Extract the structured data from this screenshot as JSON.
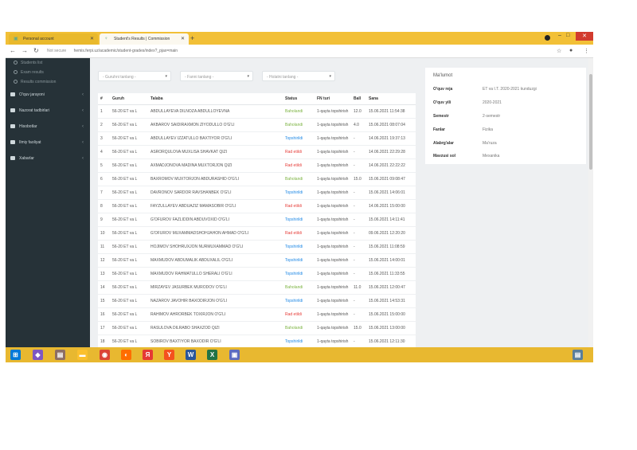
{
  "browser": {
    "tabs": [
      {
        "label": "Personal account"
      },
      {
        "label": "Student's Results | Commission"
      }
    ],
    "url": "hemis.ferpi.uz/academic/student-grades/index?_pjax=main",
    "url_security": "Not secure"
  },
  "sidebar": {
    "sub_items": [
      {
        "label": "Students list"
      },
      {
        "label": "Exam results"
      },
      {
        "label": "Results commission"
      }
    ],
    "items": [
      {
        "label": "O'quv jarayoni"
      },
      {
        "label": "Nazorat tadbirlari"
      },
      {
        "label": "Hisobotlar"
      },
      {
        "label": "Ilmiy faoliyat"
      },
      {
        "label": "Xabarlar"
      }
    ]
  },
  "filters": {
    "f1": "- Guruhni tanlang -",
    "f2": "- Fanni tanlang -",
    "f3": "- Holatni tanlang -"
  },
  "table": {
    "headers": [
      "#",
      "Guruh",
      "Talaba",
      "Status",
      "FN turi",
      "Ball",
      "Sana"
    ],
    "rows": [
      {
        "n": "1",
        "group": "56-20 ET va L",
        "student": "ABDULLAYEVA DILNOZA ABDULLOYEVNA",
        "status": "Baholandi",
        "type": "1-qayta topshirish",
        "score": "12.0",
        "date": "15.06.2021 11:54:38",
        "cls": "ok"
      },
      {
        "n": "2",
        "group": "56-20 ET va L",
        "student": "AKBAROV SAIDIRAXMON ZIYODULLO O'G'LI",
        "status": "Baholandi",
        "type": "1-qayta topshirish",
        "score": "4.0",
        "date": "15.06.2021 08:07:04",
        "cls": "ok"
      },
      {
        "n": "3",
        "group": "56-20 ET va L",
        "student": "ABDULLAYEV IZZATULLO BAXTIYOR O'G'LI",
        "status": "Topshirildi",
        "type": "1-qayta topshirish",
        "score": "-",
        "date": "14.06.2021 19:37:13",
        "cls": "sub"
      },
      {
        "n": "4",
        "group": "56-20 ET va L",
        "student": "ASRORQULOVA MUXLISA SHAVKAT QIZI",
        "status": "Rad etildi",
        "type": "1-qayta topshirish",
        "score": "-",
        "date": "14.06.2021 22:29:28",
        "cls": "bad"
      },
      {
        "n": "5",
        "group": "56-20 ET va L",
        "student": "AXMADJONOVA MADINA MUXTORJON QIZI",
        "status": "Rad etildi",
        "type": "1-qayta topshirish",
        "score": "-",
        "date": "14.06.2021 22:22:22",
        "cls": "bad"
      },
      {
        "n": "6",
        "group": "56-20 ET va L",
        "student": "BAXROMOV MUXTORJON ABDURASHID O'G'LI",
        "status": "Baholandi",
        "type": "1-qayta topshirish",
        "score": "15.0",
        "date": "15.06.2021 09:08:47",
        "cls": "ok"
      },
      {
        "n": "7",
        "group": "56-20 ET va L",
        "student": "DAVRONOV SARDOR RAVSHANBEK O'G'LI",
        "status": "Topshirildi",
        "type": "1-qayta topshirish",
        "score": "-",
        "date": "15.06.2021 14:06:01",
        "cls": "sub"
      },
      {
        "n": "8",
        "group": "56-20 ET va L",
        "student": "FAYZULLAYEV ABDUAZIZ MAMASOBIR O'G'LI",
        "status": "Rad etildi",
        "type": "1-qayta topshirish",
        "score": "-",
        "date": "14.06.2021 15:00:00",
        "cls": "bad"
      },
      {
        "n": "9",
        "group": "56-20 ET va L",
        "student": "G'OFUROV FAZLIDDIN ABDUVOXID O'G'LI",
        "status": "Topshirildi",
        "type": "1-qayta topshirish",
        "score": "-",
        "date": "15.06.2021 14:11:41",
        "cls": "sub"
      },
      {
        "n": "10",
        "group": "56-20 ET va L",
        "student": "G'OFUROV MUXAMMADSHOHJAHON AHMAD O'G'LI",
        "status": "Rad etildi",
        "type": "1-qayta topshirish",
        "score": "-",
        "date": "09.06.2021 12:20:20",
        "cls": "bad"
      },
      {
        "n": "11",
        "group": "56-20 ET va L",
        "student": "HOJIMOV SHOHRUXJON NURMUXAMMAD O'G'LI",
        "status": "Topshirildi",
        "type": "1-qayta topshirish",
        "score": "-",
        "date": "15.06.2021 11:08:59",
        "cls": "sub"
      },
      {
        "n": "12",
        "group": "56-20 ET va L",
        "student": "MAXMUDOV ABDUMALIK ABDUXALIL O'G'LI",
        "status": "Topshirildi",
        "type": "1-qayta topshirish",
        "score": "-",
        "date": "15.06.2021 14:00:01",
        "cls": "sub"
      },
      {
        "n": "13",
        "group": "56-20 ET va L",
        "student": "MAXMUDOV RAHMATULLO SHERALI O'G'LI",
        "status": "Topshirildi",
        "type": "1-qayta topshirish",
        "score": "-",
        "date": "15.06.2021 11:33:55",
        "cls": "sub"
      },
      {
        "n": "14",
        "group": "56-20 ET va L",
        "student": "MIRZAYEV JASURBEK MURODOV O'G'LI",
        "status": "Baholandi",
        "type": "1-qayta topshirish",
        "score": "11.0",
        "date": "15.06.2021 12:00:47",
        "cls": "ok"
      },
      {
        "n": "15",
        "group": "56-20 ET va L",
        "student": "NAZAROV JAVOHIR BAXODIRJON O'G'LI",
        "status": "Topshirildi",
        "type": "1-qayta topshirish",
        "score": "-",
        "date": "15.06.2021 14:53:31",
        "cls": "sub"
      },
      {
        "n": "16",
        "group": "56-20 ET va L",
        "student": "RAHIMOV AHRORBEK TOXIRJON O'G'LI",
        "status": "Rad etildi",
        "type": "1-qayta topshirish",
        "score": "-",
        "date": "15.06.2021 15:00:00",
        "cls": "bad"
      },
      {
        "n": "17",
        "group": "56-20 ET va L",
        "student": "RASULOVA DILRABO SHAXZOD QIZI",
        "status": "Baholandi",
        "type": "1-qayta topshirish",
        "score": "15.0",
        "date": "15.06.2021 13:00:00",
        "cls": "ok"
      },
      {
        "n": "18",
        "group": "56-20 ET va L",
        "student": "SOBIROV BAXTIYOR BAXODIR O'G'LI",
        "status": "Topshirildi",
        "type": "1-qayta topshirish",
        "score": "-",
        "date": "15.06.2021 12:11:30",
        "cls": "sub"
      }
    ]
  },
  "info": {
    "title": "Ma'lumot",
    "rows": [
      {
        "k": "O'quv reja",
        "v": "ET va I.T. 2020-2021 kunduzgi"
      },
      {
        "k": "O'quv yili",
        "v": "2020-2021"
      },
      {
        "k": "Semestr",
        "v": "2-semestr"
      },
      {
        "k": "Fanlar",
        "v": "Fizika"
      },
      {
        "k": "Alabrg'alar",
        "v": "Ma'ruza"
      },
      {
        "k": "Mavzusi sol",
        "v": "Mexanika"
      }
    ]
  },
  "colors": {
    "accent": "#f2c037",
    "sidebar": "#263238",
    "ok": "#7cb342",
    "bad": "#e53935",
    "sub": "#1e88e5"
  }
}
